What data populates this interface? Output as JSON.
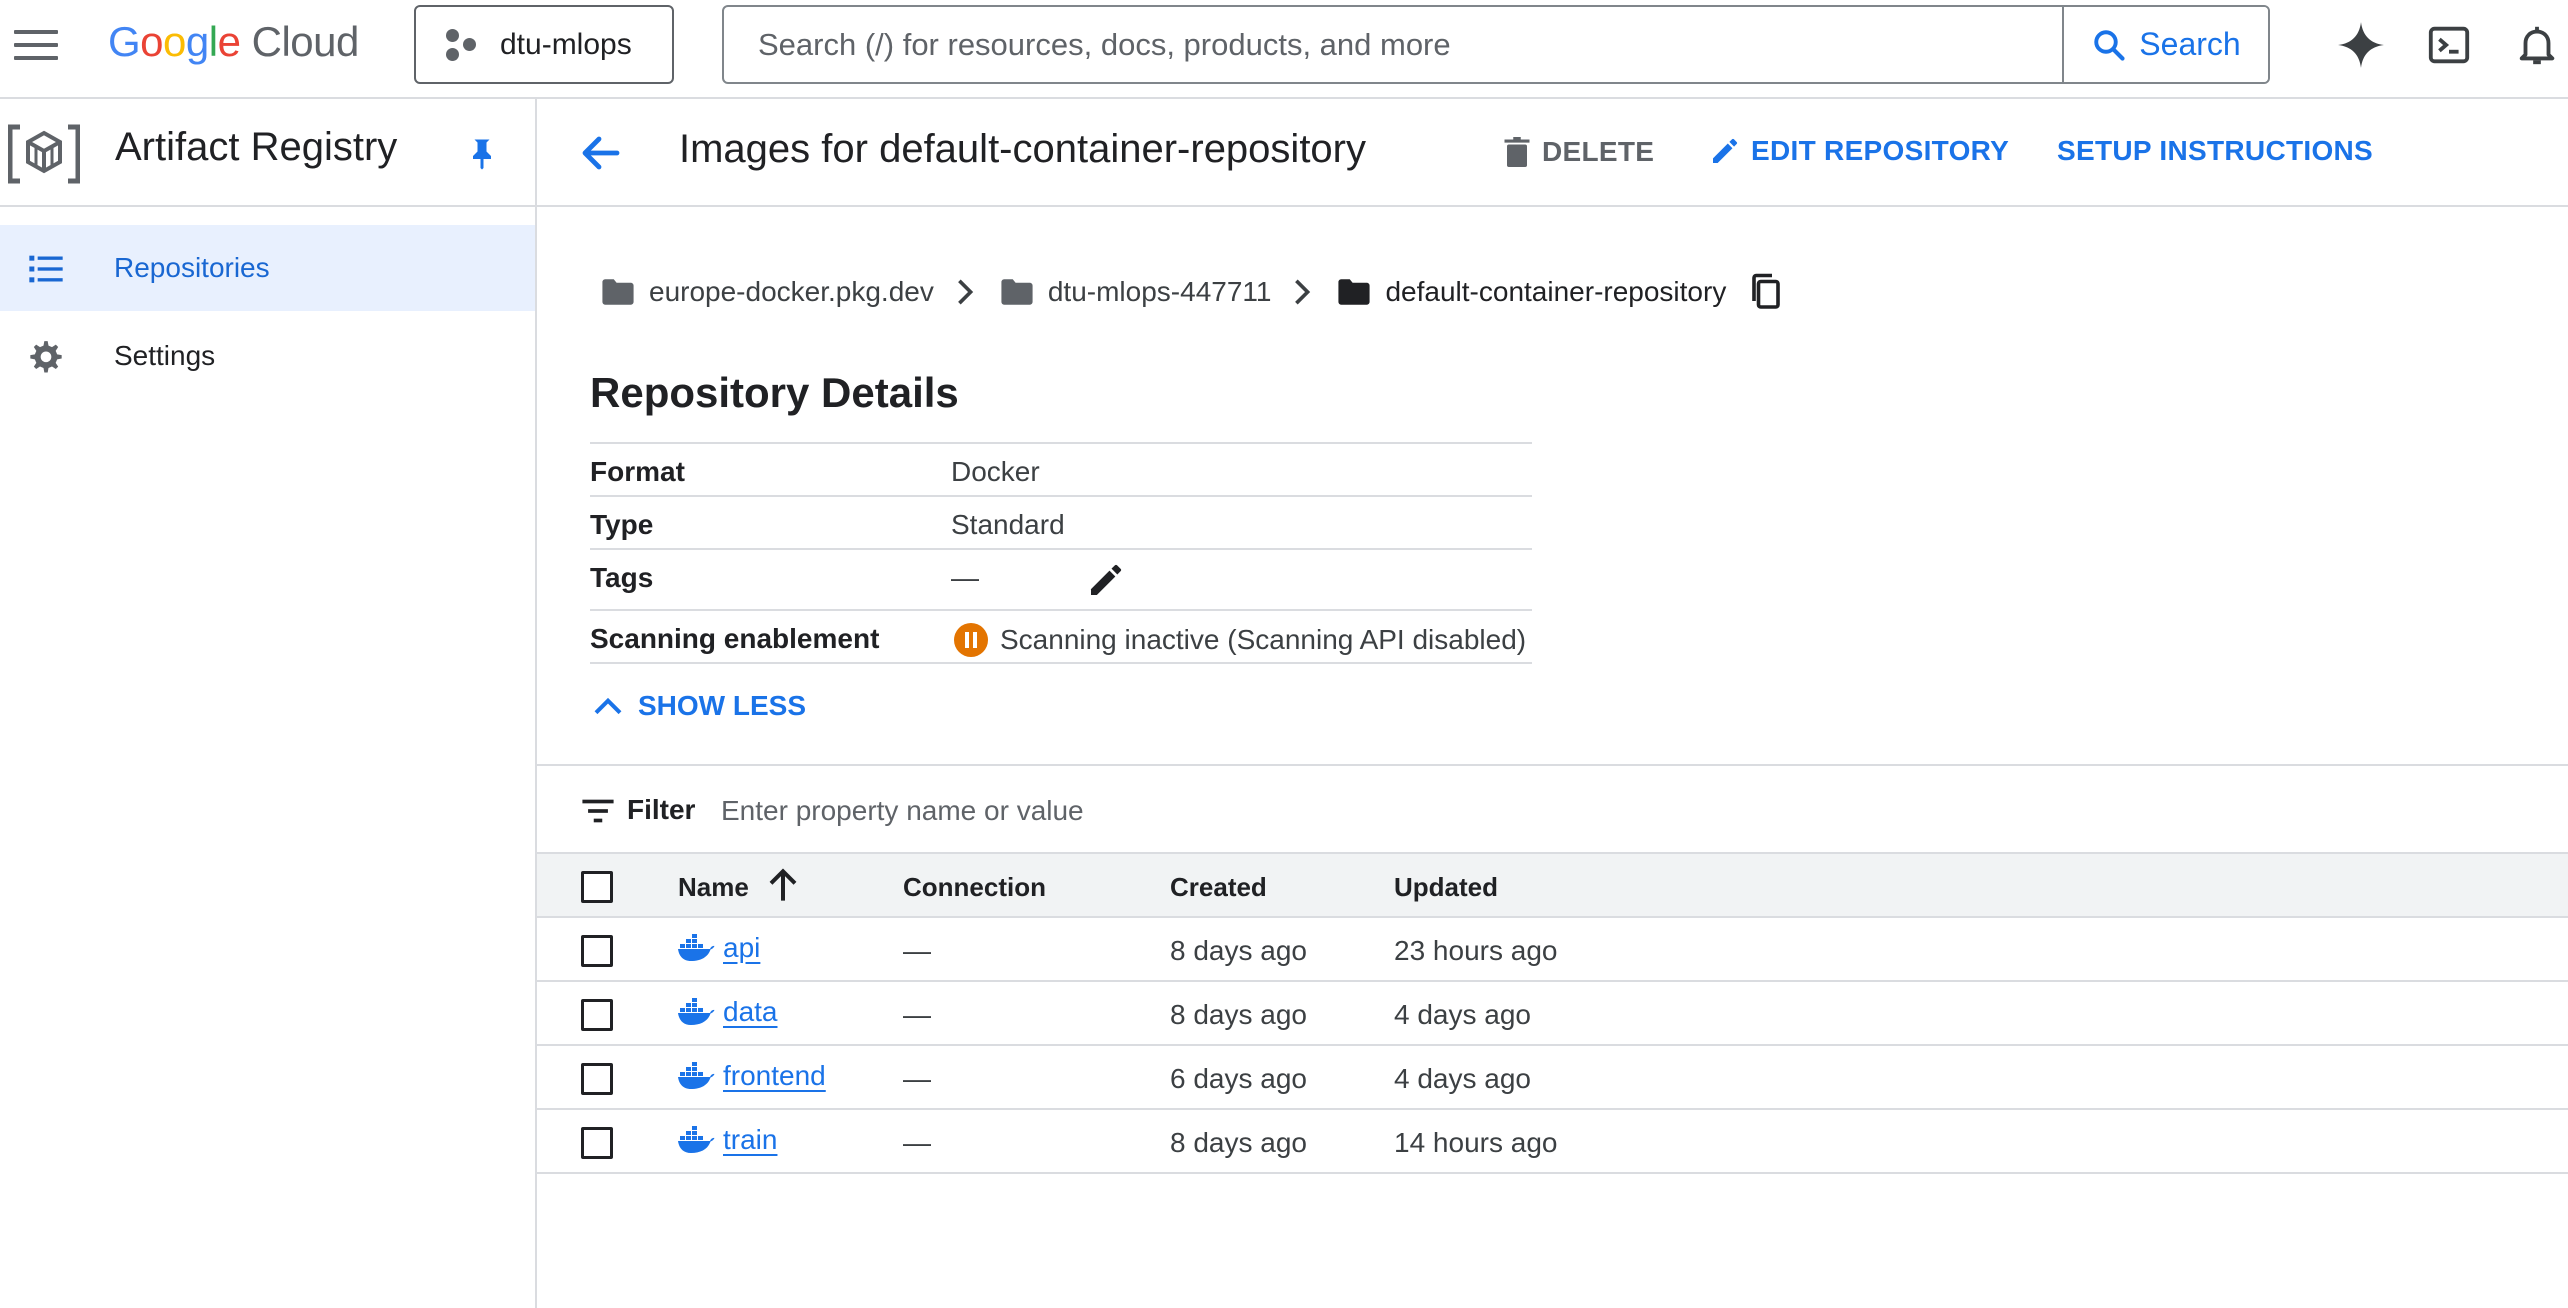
{
  "topbar": {
    "logo": {
      "brand": "Google",
      "product": "Cloud"
    },
    "project": "dtu-mlops",
    "search": {
      "placeholder": "Search (/) for resources, docs, products, and more",
      "button_label": "Search"
    },
    "icons": [
      "gemini-icon",
      "cloud-shell-icon",
      "notifications-icon"
    ]
  },
  "sidebar": {
    "title": "Artifact Registry",
    "items": [
      {
        "label": "Repositories",
        "icon": "list-icon",
        "active": true
      },
      {
        "label": "Settings",
        "icon": "gear-icon",
        "active": false
      }
    ]
  },
  "header": {
    "title": "Images for default-container-repository",
    "actions": {
      "delete": "DELETE",
      "edit": "EDIT REPOSITORY",
      "setup": "SETUP INSTRUCTIONS"
    }
  },
  "breadcrumb": {
    "items": [
      "europe-docker.pkg.dev",
      "dtu-mlops-447711",
      "default-container-repository"
    ]
  },
  "details": {
    "title": "Repository Details",
    "rows": [
      {
        "key": "Format",
        "value": "Docker"
      },
      {
        "key": "Type",
        "value": "Standard"
      },
      {
        "key": "Tags",
        "value": "—"
      },
      {
        "key": "Scanning enablement",
        "value": "Scanning inactive (Scanning API disabled)"
      }
    ],
    "toggle_label": "SHOW LESS"
  },
  "filter": {
    "label": "Filter",
    "placeholder": "Enter property name or value"
  },
  "table": {
    "columns": [
      "Name",
      "Connection",
      "Created",
      "Updated"
    ],
    "sort": {
      "column": "Name",
      "direction": "ascending"
    },
    "rows": [
      {
        "name": "api",
        "connection": "—",
        "created": "8 days ago",
        "updated": "23 hours ago"
      },
      {
        "name": "data",
        "connection": "—",
        "created": "8 days ago",
        "updated": "4 days ago"
      },
      {
        "name": "frontend",
        "connection": "—",
        "created": "6 days ago",
        "updated": "4 days ago"
      },
      {
        "name": "train",
        "connection": "—",
        "created": "8 days ago",
        "updated": "14 hours ago"
      }
    ]
  },
  "colors": {
    "accent": "#1a73e8",
    "active_nav_bg": "#e8f0fe",
    "warning": "#e37400",
    "border": "#dadce0",
    "table_header_bg": "#f1f3f4"
  }
}
